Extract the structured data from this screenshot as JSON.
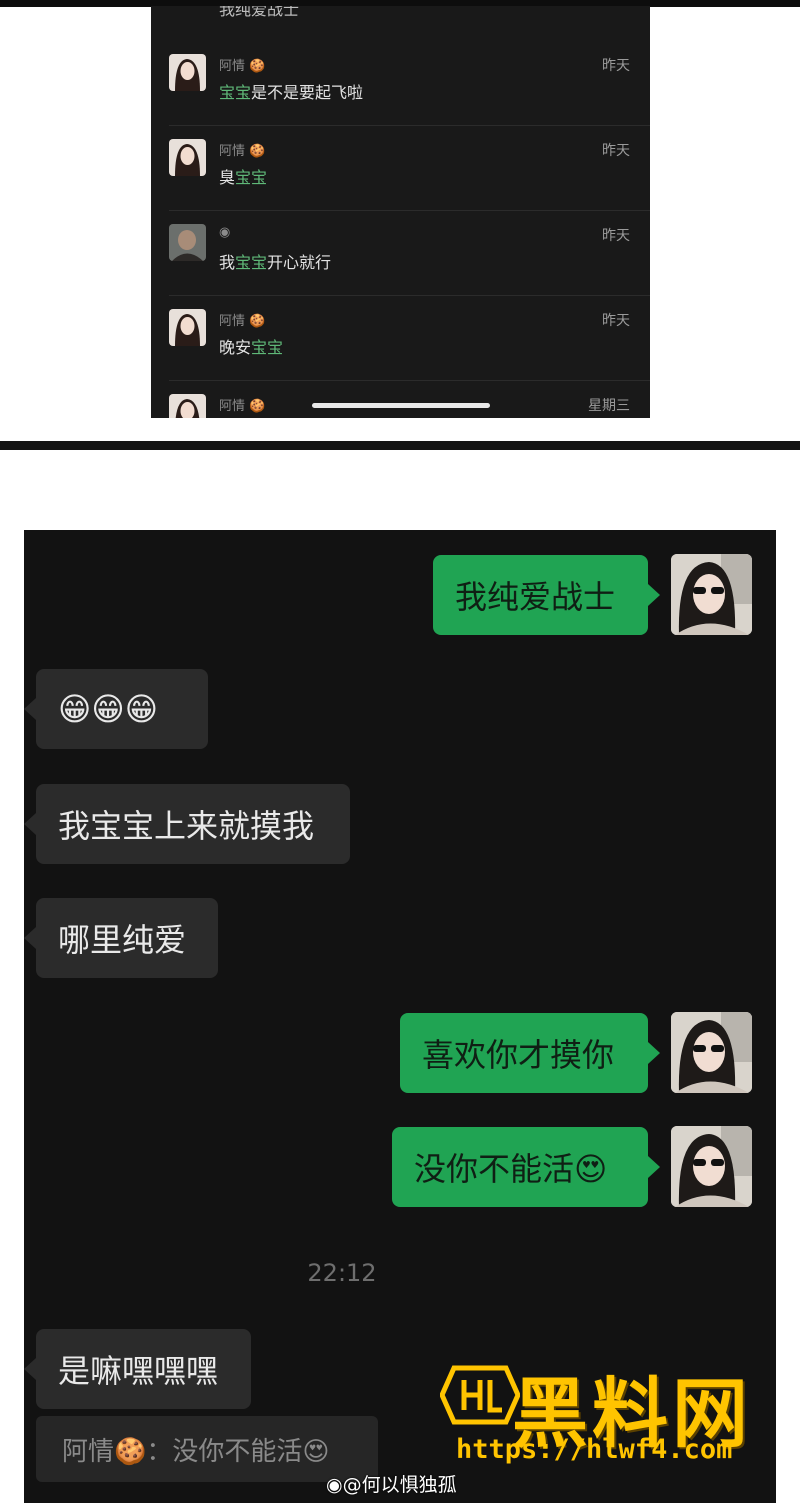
{
  "comments": {
    "partial_top_text": "我纯爱战士",
    "items": [
      {
        "name": "阿情",
        "name_icon": "cookie-icon",
        "text_parts": [
          {
            "t": "宝宝",
            "hl": true
          },
          {
            "t": "是不是要起飞啦",
            "hl": false
          }
        ],
        "time": "昨天"
      },
      {
        "name": "阿情",
        "name_icon": "cookie-icon",
        "text_parts": [
          {
            "t": "臭",
            "hl": false
          },
          {
            "t": "宝宝",
            "hl": true
          }
        ],
        "time": "昨天"
      },
      {
        "name": "",
        "name_icon": "eye-icon",
        "text_parts": [
          {
            "t": "我",
            "hl": false
          },
          {
            "t": "宝宝",
            "hl": true
          },
          {
            "t": "开心就行",
            "hl": false
          }
        ],
        "time": "昨天"
      },
      {
        "name": "阿情",
        "name_icon": "cookie-icon",
        "text_parts": [
          {
            "t": "晚安",
            "hl": false
          },
          {
            "t": "宝宝",
            "hl": true
          }
        ],
        "time": "昨天"
      },
      {
        "name": "阿情",
        "name_icon": "cookie-icon",
        "text_parts": [],
        "time": "星期三"
      }
    ]
  },
  "chat": {
    "messages": [
      {
        "side": "me",
        "text": "我纯爱战士"
      },
      {
        "side": "other",
        "text": "😁😁😁"
      },
      {
        "side": "other",
        "text": "我宝宝上来就摸我"
      },
      {
        "side": "other",
        "text": "哪里纯爱"
      },
      {
        "side": "me",
        "text": "喜欢你才摸你"
      },
      {
        "side": "me",
        "text": "没你不能活😍"
      },
      {
        "side": "other",
        "text": "是嘛嘿嘿嘿"
      }
    ],
    "timestamp": "22:12",
    "quote": "阿情🍪：没你不能活😍"
  },
  "watermark": {
    "title": "黑料网",
    "url": "https://hlwf4.com",
    "weibo": "@何以惧独孤"
  },
  "colors": {
    "bubble_me": "#20a453",
    "bubble_other": "#2b2b2b",
    "chat_bg": "#121212",
    "highlight": "#5fb878",
    "watermark": "#ffc400"
  }
}
